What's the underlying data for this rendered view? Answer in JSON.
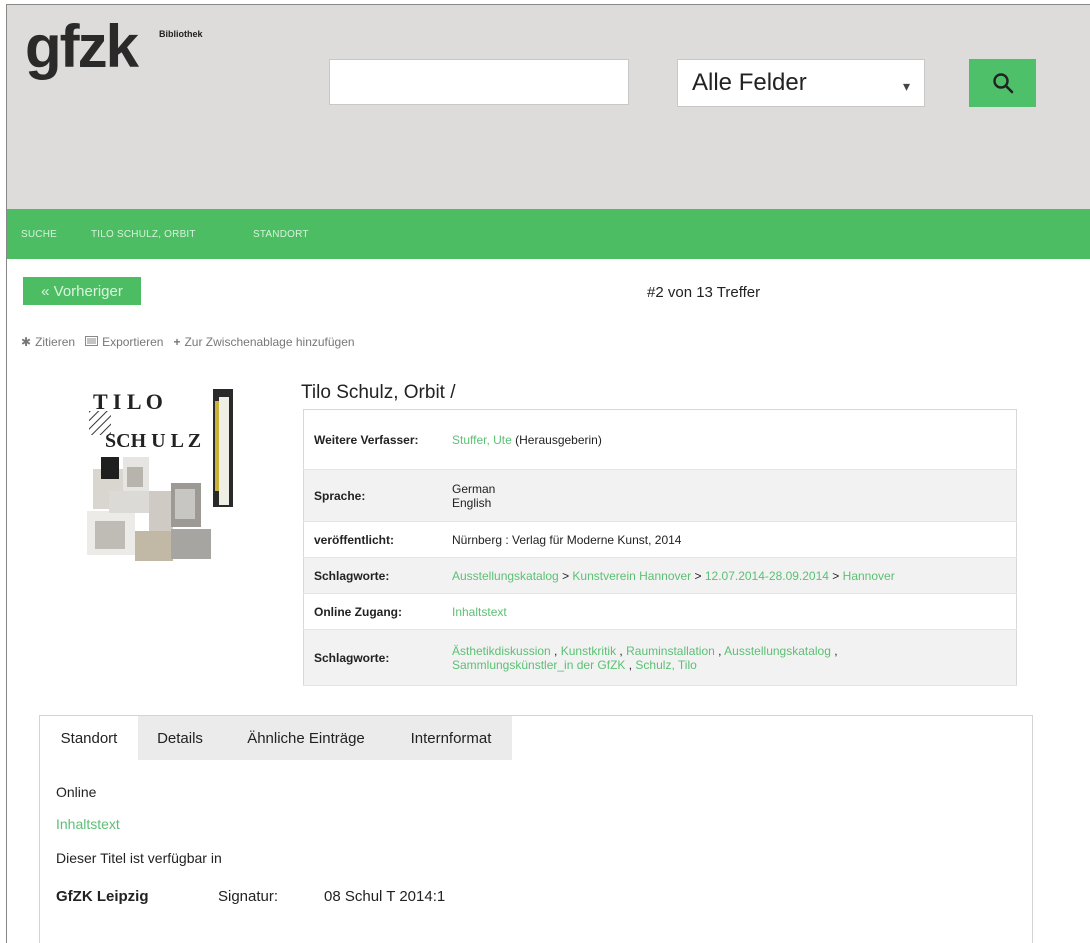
{
  "logo": {
    "text": "gfzk",
    "sub": "Bibliothek"
  },
  "search": {
    "value": "",
    "placeholder": "",
    "field_select": "Alle Felder",
    "button_icon": "search-icon"
  },
  "breadcrumb": [
    "SUCHE",
    "TILO SCHULZ, ORBIT",
    "STANDORT"
  ],
  "pager": {
    "prev_label": "« Vorheriger",
    "result_text": "#2 von 13 Treffer"
  },
  "toolbar": [
    {
      "icon": "asterisk-icon",
      "label": "Zitieren"
    },
    {
      "icon": "export-icon",
      "label": "Exportieren"
    },
    {
      "icon": "plus-icon",
      "label": "Zur Zwischenablage hinzufügen"
    }
  ],
  "cover": {
    "letters_top": "T I L O",
    "letters_bottom": "SCH U L Z"
  },
  "record": {
    "title": "Tilo Schulz, Orbit /",
    "rows": [
      {
        "label": "Weitere Verfasser:",
        "link": "Stuffer, Ute",
        "text": " (Herausgeberin)"
      },
      {
        "label": "Sprache:",
        "line1": "German",
        "line2": "English"
      },
      {
        "label": "veröffentlicht:",
        "text": "Nürnberg : Verlag für Moderne Kunst, 2014"
      },
      {
        "label": "Schlagworte:",
        "items": [
          "Ausstellungskatalog",
          "Kunstverein Hannover",
          "12.07.2014-28.09.2014",
          "Hannover"
        ],
        "sep": " > "
      },
      {
        "label": "Online Zugang:",
        "link": "Inhaltstext"
      },
      {
        "label": "Schlagworte:",
        "items": [
          "Ästhetikdiskussion",
          "Kunstkritik",
          "Rauminstallation",
          "Ausstellungskatalog",
          "Sammlungskünstler_in der GfZK",
          "Schulz, Tilo"
        ],
        "sep": " , "
      }
    ]
  },
  "tabs": {
    "labels": [
      "Standort",
      "Details",
      "Ähnliche Einträge",
      "Internformat"
    ],
    "active": "Standort",
    "pane": {
      "online": "Online",
      "link": "Inhaltstext",
      "available": "Dieser Titel ist verfügbar in",
      "location": "GfZK Leipzig",
      "signatur_label": "Signatur:",
      "signatur_value": "08 Schul T 2014:1"
    }
  },
  "colors": {
    "accent": "#4dbd63",
    "link": "#5cc074",
    "header_bg": "#dedcda"
  }
}
